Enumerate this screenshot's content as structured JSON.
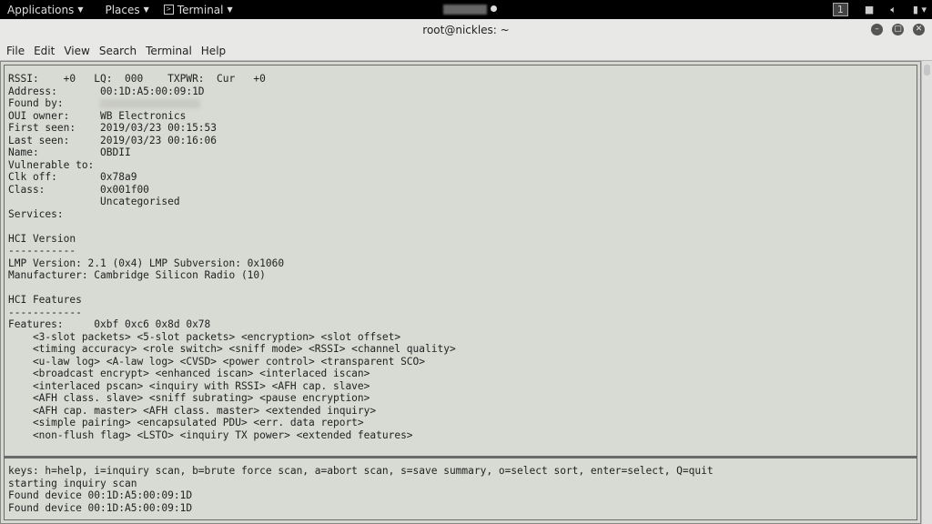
{
  "topbar": {
    "applications": "Applications",
    "places": "Places",
    "terminal": "Terminal",
    "workspace": "1"
  },
  "window": {
    "title": "root@nickles: ~"
  },
  "menu": [
    "File",
    "Edit",
    "View",
    "Search",
    "Terminal",
    "Help"
  ],
  "device": {
    "rssi_line": "RSSI:    +0   LQ:  000    TXPWR:  Cur   +0",
    "address": "Address:       00:1D:A5:00:09:1D",
    "found_by": "Found by:",
    "oui": "OUI owner:     WB Electronics",
    "first_seen": "First seen:    2019/03/23 00:15:53",
    "last_seen": "Last seen:     2019/03/23 00:16:06",
    "name": "Name:          OBDII",
    "vulnerable": "Vulnerable to:",
    "clk": "Clk off:       0x78a9",
    "class": "Class:         0x001f00",
    "class2": "               Uncategorised",
    "services": "Services:"
  },
  "hci_version": {
    "heading": "HCI Version",
    "rule": "-----------",
    "lmp": "LMP Version: 2.1 (0x4) LMP Subversion: 0x1060",
    "manufacturer": "Manufacturer: Cambridge Silicon Radio (10)"
  },
  "hci_features": {
    "heading": "HCI Features",
    "rule": "------------",
    "features": "Features:     0xbf 0xc6 0x8d 0x78",
    "list": [
      "    <3-slot packets> <5-slot packets> <encryption> <slot offset>",
      "    <timing accuracy> <role switch> <sniff mode> <RSSI> <channel quality>",
      "    <u-law log> <A-law log> <CVSD> <power control> <transparent SCO>",
      "    <broadcast encrypt> <enhanced iscan> <interlaced iscan>",
      "    <interlaced pscan> <inquiry with RSSI> <AFH cap. slave>",
      "    <AFH class. slave> <sniff subrating> <pause encryption>",
      "    <AFH cap. master> <AFH class. master> <extended inquiry>",
      "    <simple pairing> <encapsulated PDU> <err. data report>",
      "    <non-flush flag> <LSTO> <inquiry TX power> <extended features>"
    ]
  },
  "log": [
    "keys: h=help, i=inquiry scan, b=brute force scan, a=abort scan, s=save summary, o=select sort, enter=select, Q=quit",
    "starting inquiry scan",
    "Found device 00:1D:A5:00:09:1D",
    "Found device 00:1D:A5:00:09:1D"
  ]
}
